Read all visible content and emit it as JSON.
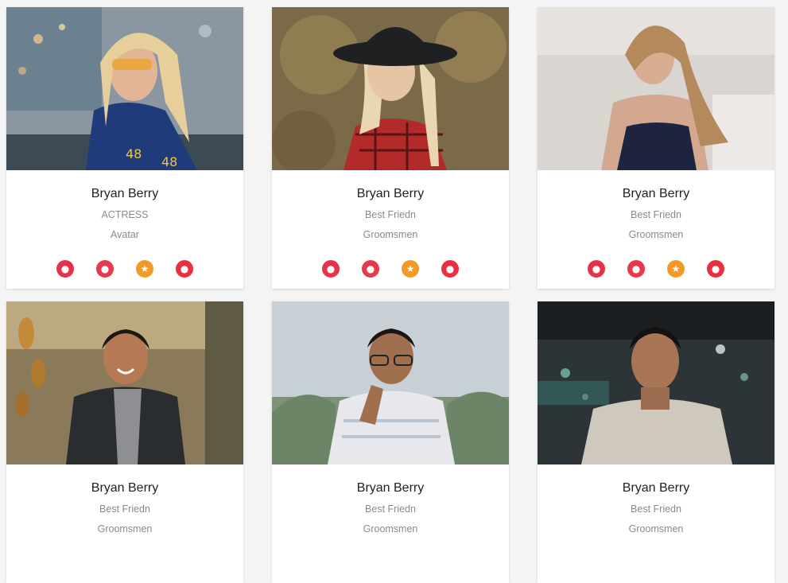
{
  "team": [
    {
      "name": "Bryan Berry",
      "role": "ACTRESS",
      "sub": "Avatar",
      "social": true
    },
    {
      "name": "Bryan Berry",
      "role": "Best Friedn",
      "sub": "Groomsmen",
      "social": true
    },
    {
      "name": "Bryan Berry",
      "role": "Best Friedn",
      "sub": "Groomsmen",
      "social": true
    },
    {
      "name": "Bryan Berry",
      "role": "Best Friedn",
      "sub": "Groomsmen",
      "social": false
    },
    {
      "name": "Bryan Berry",
      "role": "Best Friedn",
      "sub": "Groomsmen",
      "social": false
    },
    {
      "name": "Bryan Berry",
      "role": "Best Friedn",
      "sub": "Groomsmen",
      "social": false
    }
  ],
  "social_icons": [
    "weibo-icon",
    "wechat-icon",
    "qzone-icon",
    "qq-icon"
  ],
  "colors": {
    "weibo": "#e6314a",
    "wechat": "#e8384c",
    "qzone": "#f29a27",
    "qq": "#ea2f3f",
    "name_text": "#222222",
    "meta_text": "#8a8a8a"
  }
}
